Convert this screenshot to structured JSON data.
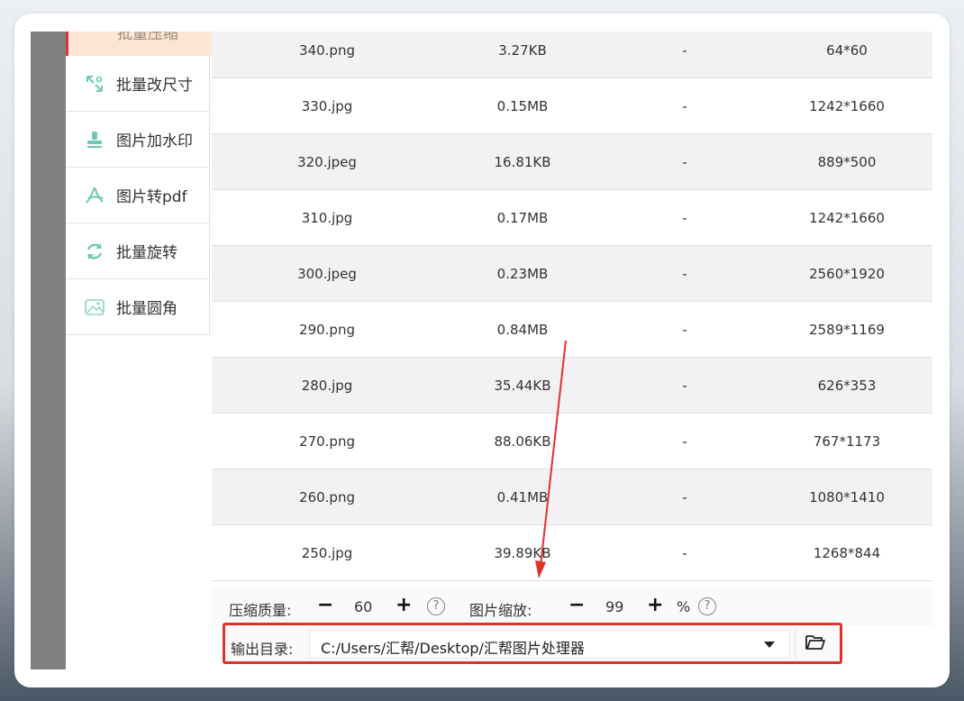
{
  "sidebar": {
    "top_label": "批量压缩",
    "items": [
      {
        "label": "批量改尺寸",
        "icon": "resize-icon"
      },
      {
        "label": "图片加水印",
        "icon": "watermark-stamp-icon"
      },
      {
        "label": "图片转pdf",
        "icon": "pdf-icon"
      },
      {
        "label": "批量旋转",
        "icon": "rotate-icon"
      },
      {
        "label": "批量圆角",
        "icon": "rounded-image-icon"
      }
    ]
  },
  "table": {
    "rows": [
      {
        "name": "340.png",
        "size": "3.27KB",
        "status": "-",
        "dims": "64*60"
      },
      {
        "name": "330.jpg",
        "size": "0.15MB",
        "status": "-",
        "dims": "1242*1660"
      },
      {
        "name": "320.jpeg",
        "size": "16.81KB",
        "status": "-",
        "dims": "889*500"
      },
      {
        "name": "310.jpg",
        "size": "0.17MB",
        "status": "-",
        "dims": "1242*1660"
      },
      {
        "name": "300.jpeg",
        "size": "0.23MB",
        "status": "-",
        "dims": "2560*1920"
      },
      {
        "name": "290.png",
        "size": "0.84MB",
        "status": "-",
        "dims": "2589*1169"
      },
      {
        "name": "280.jpg",
        "size": "35.44KB",
        "status": "-",
        "dims": "626*353"
      },
      {
        "name": "270.png",
        "size": "88.06KB",
        "status": "-",
        "dims": "767*1173"
      },
      {
        "name": "260.png",
        "size": "0.41MB",
        "status": "-",
        "dims": "1080*1410"
      },
      {
        "name": "250.jpg",
        "size": "39.89KB",
        "status": "-",
        "dims": "1268*844"
      }
    ]
  },
  "controls": {
    "quality_label": "压缩质量:",
    "minus": "−",
    "plus": "+",
    "quality_value": "60",
    "scale_label": "图片缩放:",
    "scale_value": "99",
    "percent": "%",
    "help": "?"
  },
  "output": {
    "label": "输出目录:",
    "path": "C:/Users/汇帮/Desktop/汇帮图片处理器"
  },
  "colors": {
    "highlight_red": "#e0312b",
    "icon_teal": "#6cc9b3",
    "sidebar_active_bg": "#fde5d3"
  }
}
